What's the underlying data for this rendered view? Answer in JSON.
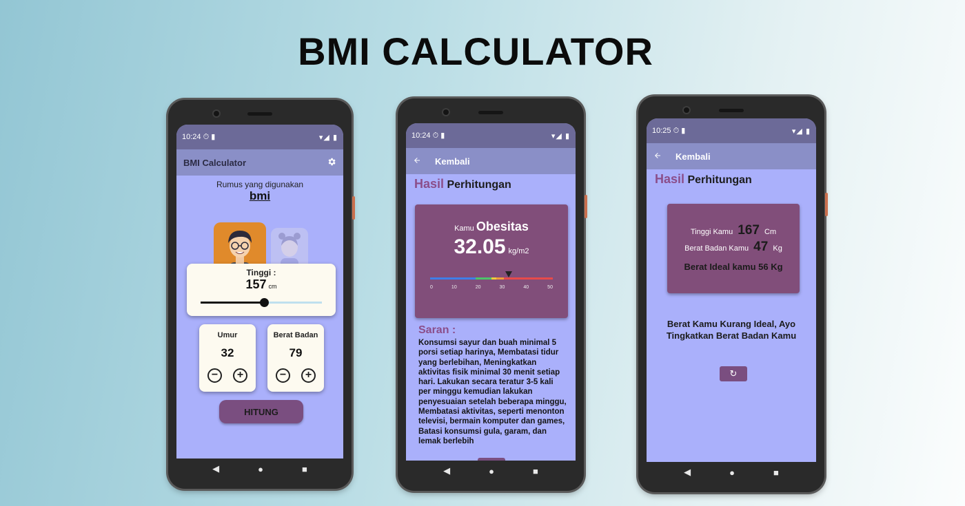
{
  "page": {
    "title": "BMI CALCULATOR"
  },
  "phone1": {
    "status": {
      "time": "10:24",
      "icons_left": "⏱ ▮",
      "icons_right": "▾◢ ▮"
    },
    "appbar": {
      "title": "BMI Calculator"
    },
    "formula": {
      "label": "Rumus yang digunakan",
      "value": "bmi"
    },
    "height": {
      "label": "Tinggi :",
      "value": "157",
      "unit": "cm",
      "slider_fraction": 0.52
    },
    "age": {
      "label": "Umur",
      "value": "32",
      "minus": "−",
      "plus": "+"
    },
    "weight": {
      "label": "Berat Badan",
      "value": "79",
      "minus": "−",
      "plus": "+"
    },
    "calculate_label": "HITUNG"
  },
  "phone2": {
    "status": {
      "time": "10:24",
      "icons_left": "⏱ ▮",
      "icons_right": "▾◢ ▮"
    },
    "appbar": {
      "back_label": "Kembali"
    },
    "title_accent": "Hasil",
    "title_rest": "Perhitungan",
    "result": {
      "prefix": "Kamu",
      "category": "Obesitas",
      "bmi": "32.05",
      "unit": "kg/m2"
    },
    "scale": {
      "ticks": [
        "0",
        "10",
        "20",
        "30",
        "40",
        "50"
      ],
      "pointer_value": 32.05,
      "max": 50,
      "segments": [
        {
          "to": 18.5,
          "color": "#3f7ee8"
        },
        {
          "to": 25,
          "color": "#4cc46a"
        },
        {
          "to": 27,
          "color": "#f2cc3a"
        },
        {
          "to": 30,
          "color": "#f29b3a"
        },
        {
          "to": 50,
          "color": "#e84a4a"
        }
      ]
    },
    "saran_title": "Saran :",
    "saran_text": "Konsumsi sayur dan buah minimal 5 porsi setiap harinya, Membatasi tidur yang berlebihan, Meningkatkan aktivitas fisik minimal 30 menit setiap hari. Lakukan secara teratur 3-5 kali per minggu kemudian lakukan penyesuaian setelah beberapa minggu, Membatasi aktivitas, seperti menonton televisi, bermain komputer dan games, Batasi konsumsi gula, garam, dan lemak berlebih"
  },
  "phone3": {
    "status": {
      "time": "10:25",
      "icons_left": "⏱ ▮",
      "icons_right": "▾◢ ▮"
    },
    "appbar": {
      "back_label": "Kembali"
    },
    "title_accent": "Hasil",
    "title_rest": "Perhitungan",
    "height": {
      "label": "Tinggi Kamu",
      "value": "167",
      "unit": "Cm"
    },
    "weight": {
      "label": "Berat Badan Kamu",
      "value": "47",
      "unit": "Kg"
    },
    "ideal": "Berat Ideal kamu 56 Kg",
    "verdict": "Berat Kamu Kurang Ideal, Ayo Tingkatkan Berat Badan Kamu"
  },
  "nav": {
    "back": "◀",
    "home": "●",
    "recents": "■"
  },
  "icons": {
    "settings": "gear-icon",
    "back_arrow": "arrow-left-icon",
    "refresh": "refresh-icon"
  }
}
